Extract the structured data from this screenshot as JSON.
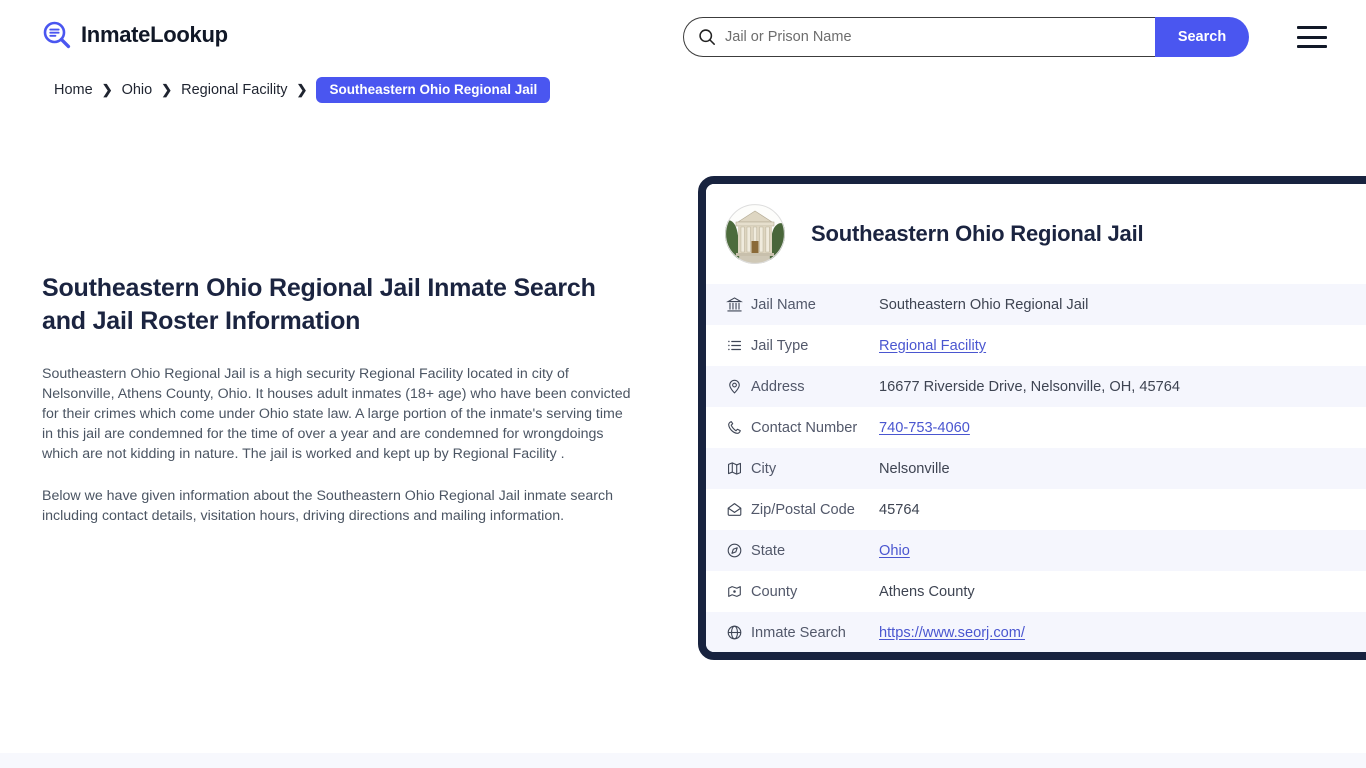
{
  "brand": {
    "name": "InmateLookup",
    "icon": "search-list-logo-icon",
    "color": "#4a56f0"
  },
  "search": {
    "placeholder": "Jail or Prison Name",
    "value": "",
    "button_label": "Search",
    "icon": "search-icon",
    "button_color": "#4a56f0"
  },
  "menu": {
    "icon": "hamburger-menu-icon"
  },
  "breadcrumb": {
    "items": [
      {
        "label": "Home",
        "current": false
      },
      {
        "label": "Ohio",
        "current": false
      },
      {
        "label": "Regional Facility",
        "current": false
      },
      {
        "label": "Southeastern Ohio Regional Jail",
        "current": true
      }
    ],
    "separator": "❯",
    "current_bg": "#4a56f0"
  },
  "main": {
    "title": "Southeastern Ohio Regional Jail Inmate Search and Jail Roster Information",
    "paragraphs": [
      "Southeastern Ohio Regional Jail is a high security Regional Facility located in city of Nelsonville, Athens County, Ohio. It houses adult inmates (18+ age) who have been convicted for their crimes which come under Ohio state law. A large portion of the inmate's serving time in this jail are condemned for the time of over a year and are condemned for wrongdoings which are not kidding in nature. The jail is worked and kept up by Regional Facility .",
      "Below we have given information about the Southeastern Ohio Regional Jail inmate search including contact details, visitation hours, driving directions and mailing information."
    ]
  },
  "card": {
    "photo_alt": "courthouse-building-photo",
    "title": "Southeastern Ohio Regional Jail",
    "border_color": "#18233f",
    "rows": [
      {
        "icon": "bank-icon",
        "label": "Jail Name",
        "value": "Southeastern Ohio Regional Jail",
        "link": false
      },
      {
        "icon": "list-icon",
        "label": "Jail Type",
        "value": "Regional Facility",
        "link": true
      },
      {
        "icon": "map-pin-icon",
        "label": "Address",
        "value": "16677 Riverside Drive, Nelsonville, OH, 45764",
        "link": false
      },
      {
        "icon": "phone-icon",
        "label": "Contact Number",
        "value": "740-753-4060",
        "link": true
      },
      {
        "icon": "map-icon",
        "label": "City",
        "value": "Nelsonville",
        "link": false
      },
      {
        "icon": "envelope-icon",
        "label": "Zip/Postal Code",
        "value": "45764",
        "link": false
      },
      {
        "icon": "compass-icon",
        "label": "State",
        "value": "Ohio",
        "link": true
      },
      {
        "icon": "county-map-icon",
        "label": "County",
        "value": "Athens County",
        "link": false
      },
      {
        "icon": "globe-icon",
        "label": "Inmate Search",
        "value": "https://www.seorj.com/",
        "link": true
      }
    ]
  }
}
